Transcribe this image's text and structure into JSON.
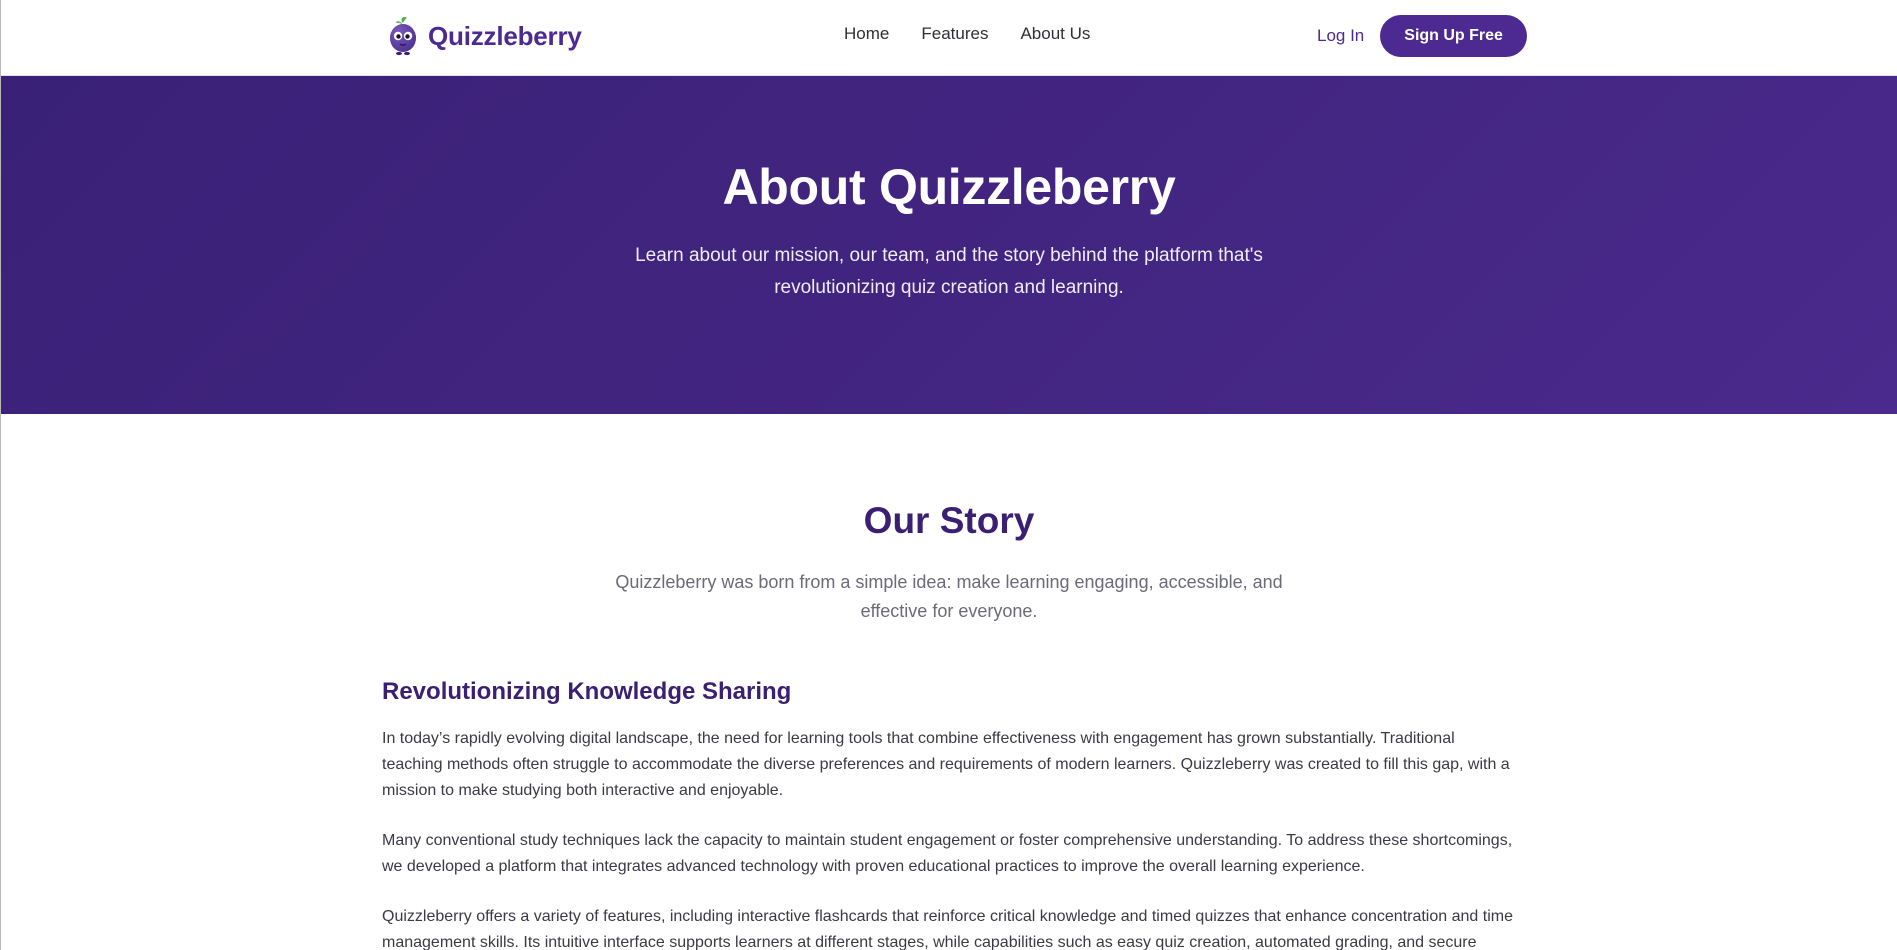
{
  "brand": {
    "name": "Quizzleberry",
    "logo_icon": "blueberry-mascot-icon",
    "primary_color": "#4c2a91",
    "heading_color": "#3b1f72"
  },
  "nav": {
    "links": [
      {
        "label": "Home"
      },
      {
        "label": "Features"
      },
      {
        "label": "About Us"
      }
    ],
    "login_label": "Log In",
    "signup_label": "Sign Up Free"
  },
  "hero": {
    "title": "About Quizzleberry",
    "subtitle": "Learn about our mission, our team, and the story behind the platform that's revolutionizing quiz creation and learning.",
    "background_start": "#3a2177",
    "background_end": "#4a2a8c"
  },
  "story": {
    "title": "Our Story",
    "lead": "Quizzleberry was born from a simple idea: make learning engaging, accessible, and effective for everyone.",
    "section_heading": "Revolutionizing Knowledge Sharing",
    "paragraphs": [
      "In today’s rapidly evolving digital landscape, the need for learning tools that combine effectiveness with engagement has grown substantially. Traditional teaching methods often struggle to accommodate the diverse preferences and requirements of modern learners. Quizzleberry was created to fill this gap, with a mission to make studying both interactive and enjoyable.",
      "Many conventional study techniques lack the capacity to maintain student engagement or foster comprehensive understanding. To address these shortcomings, we developed a platform that integrates advanced technology with proven educational practices to improve the overall learning experience.",
      "Quizzleberry offers a variety of features, including interactive flashcards that reinforce critical knowledge and timed quizzes that enhance concentration and time management skills. Its intuitive interface supports learners at different stages, while capabilities such as easy quiz creation, automated grading, and secure"
    ]
  }
}
